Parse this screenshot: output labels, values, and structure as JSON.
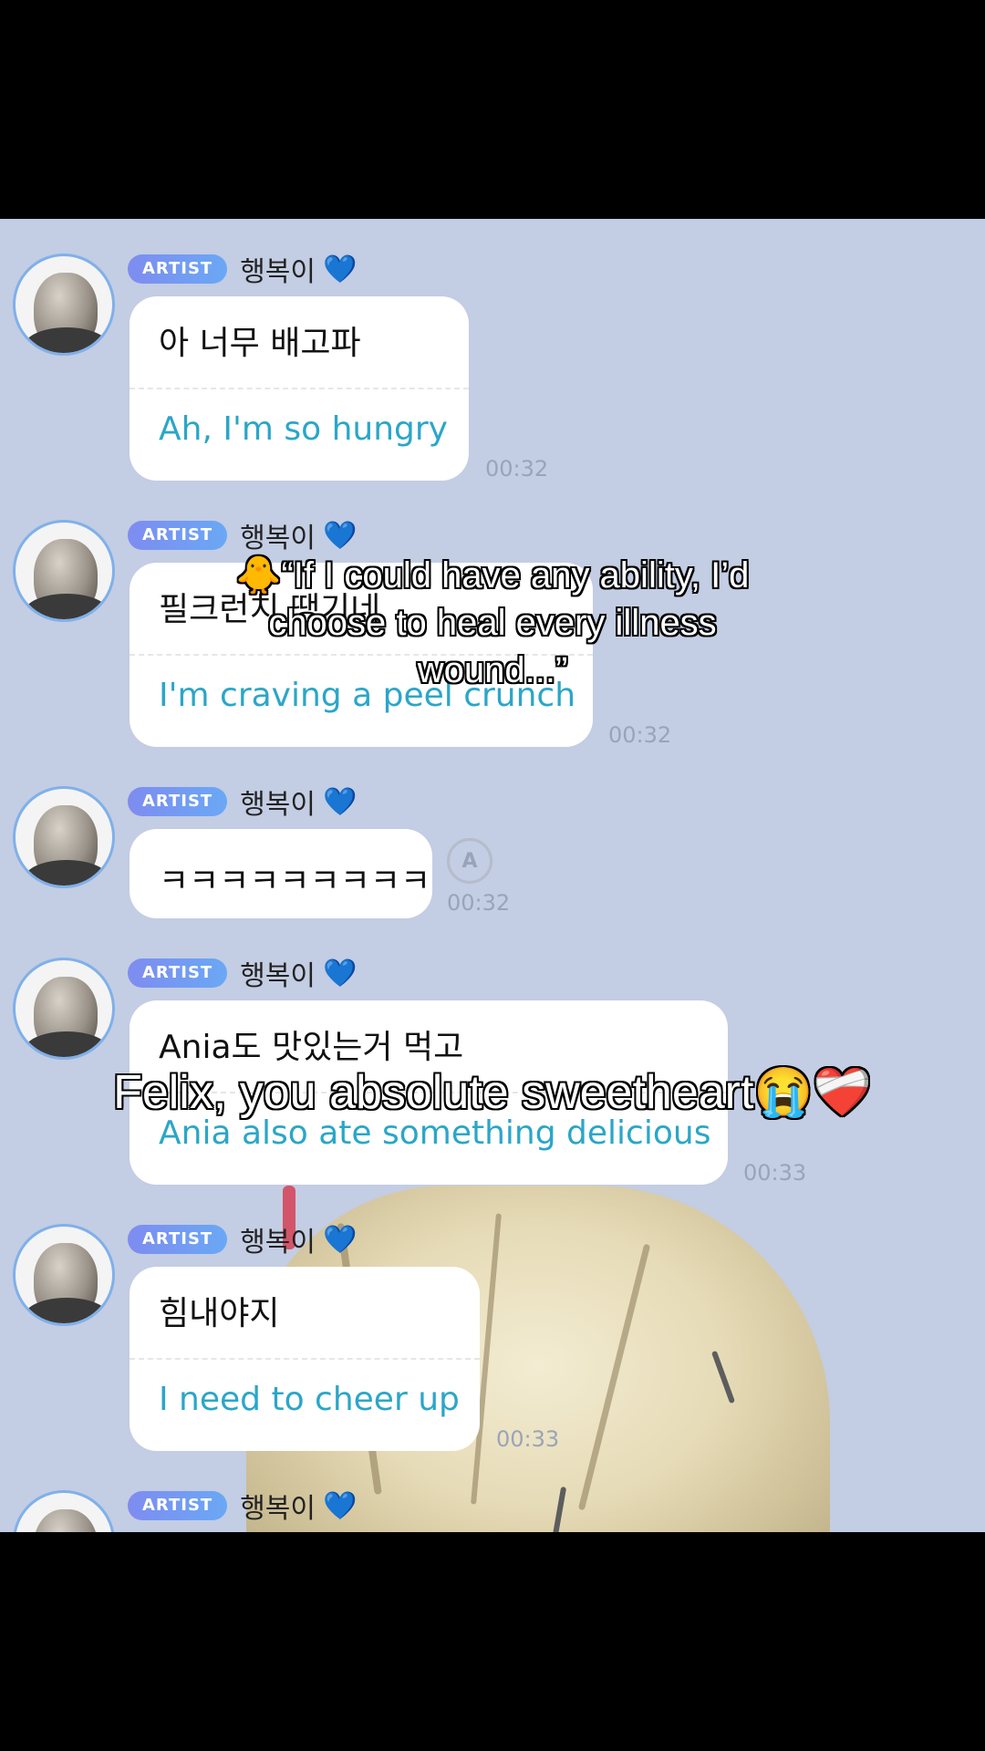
{
  "sender": {
    "badge": "ARTIST",
    "name": "행복이",
    "heart": "💙"
  },
  "messages": [
    {
      "korean": "아 너무 배고파",
      "english": "Ah, I'm so hungry",
      "time": "00:32"
    },
    {
      "korean": "필크런치 땡기네",
      "english": "I'm craving a peel crunch",
      "time": "00:32"
    },
    {
      "korean": "ㅋㅋㅋㅋㅋㅋㅋㅋㅋ",
      "time": "00:32",
      "retry_label": "A"
    },
    {
      "korean": "Ania도 맛있는거 먹고",
      "english": "Ania also ate something delicious",
      "time": "00:33"
    },
    {
      "korean": "힘내야지",
      "english": "I need to cheer up",
      "time": "00:33"
    }
  ],
  "overlay_captions": [
    "🐥“If I could have any ability, I’d choose to heal every illness wound...”",
    "Felix, you absolute sweetheart😭❤️‍🩹"
  ],
  "colors": {
    "chat_bg": "#c3cde3",
    "translation": "#2ba6c8",
    "badge": "#7e8cf0"
  }
}
